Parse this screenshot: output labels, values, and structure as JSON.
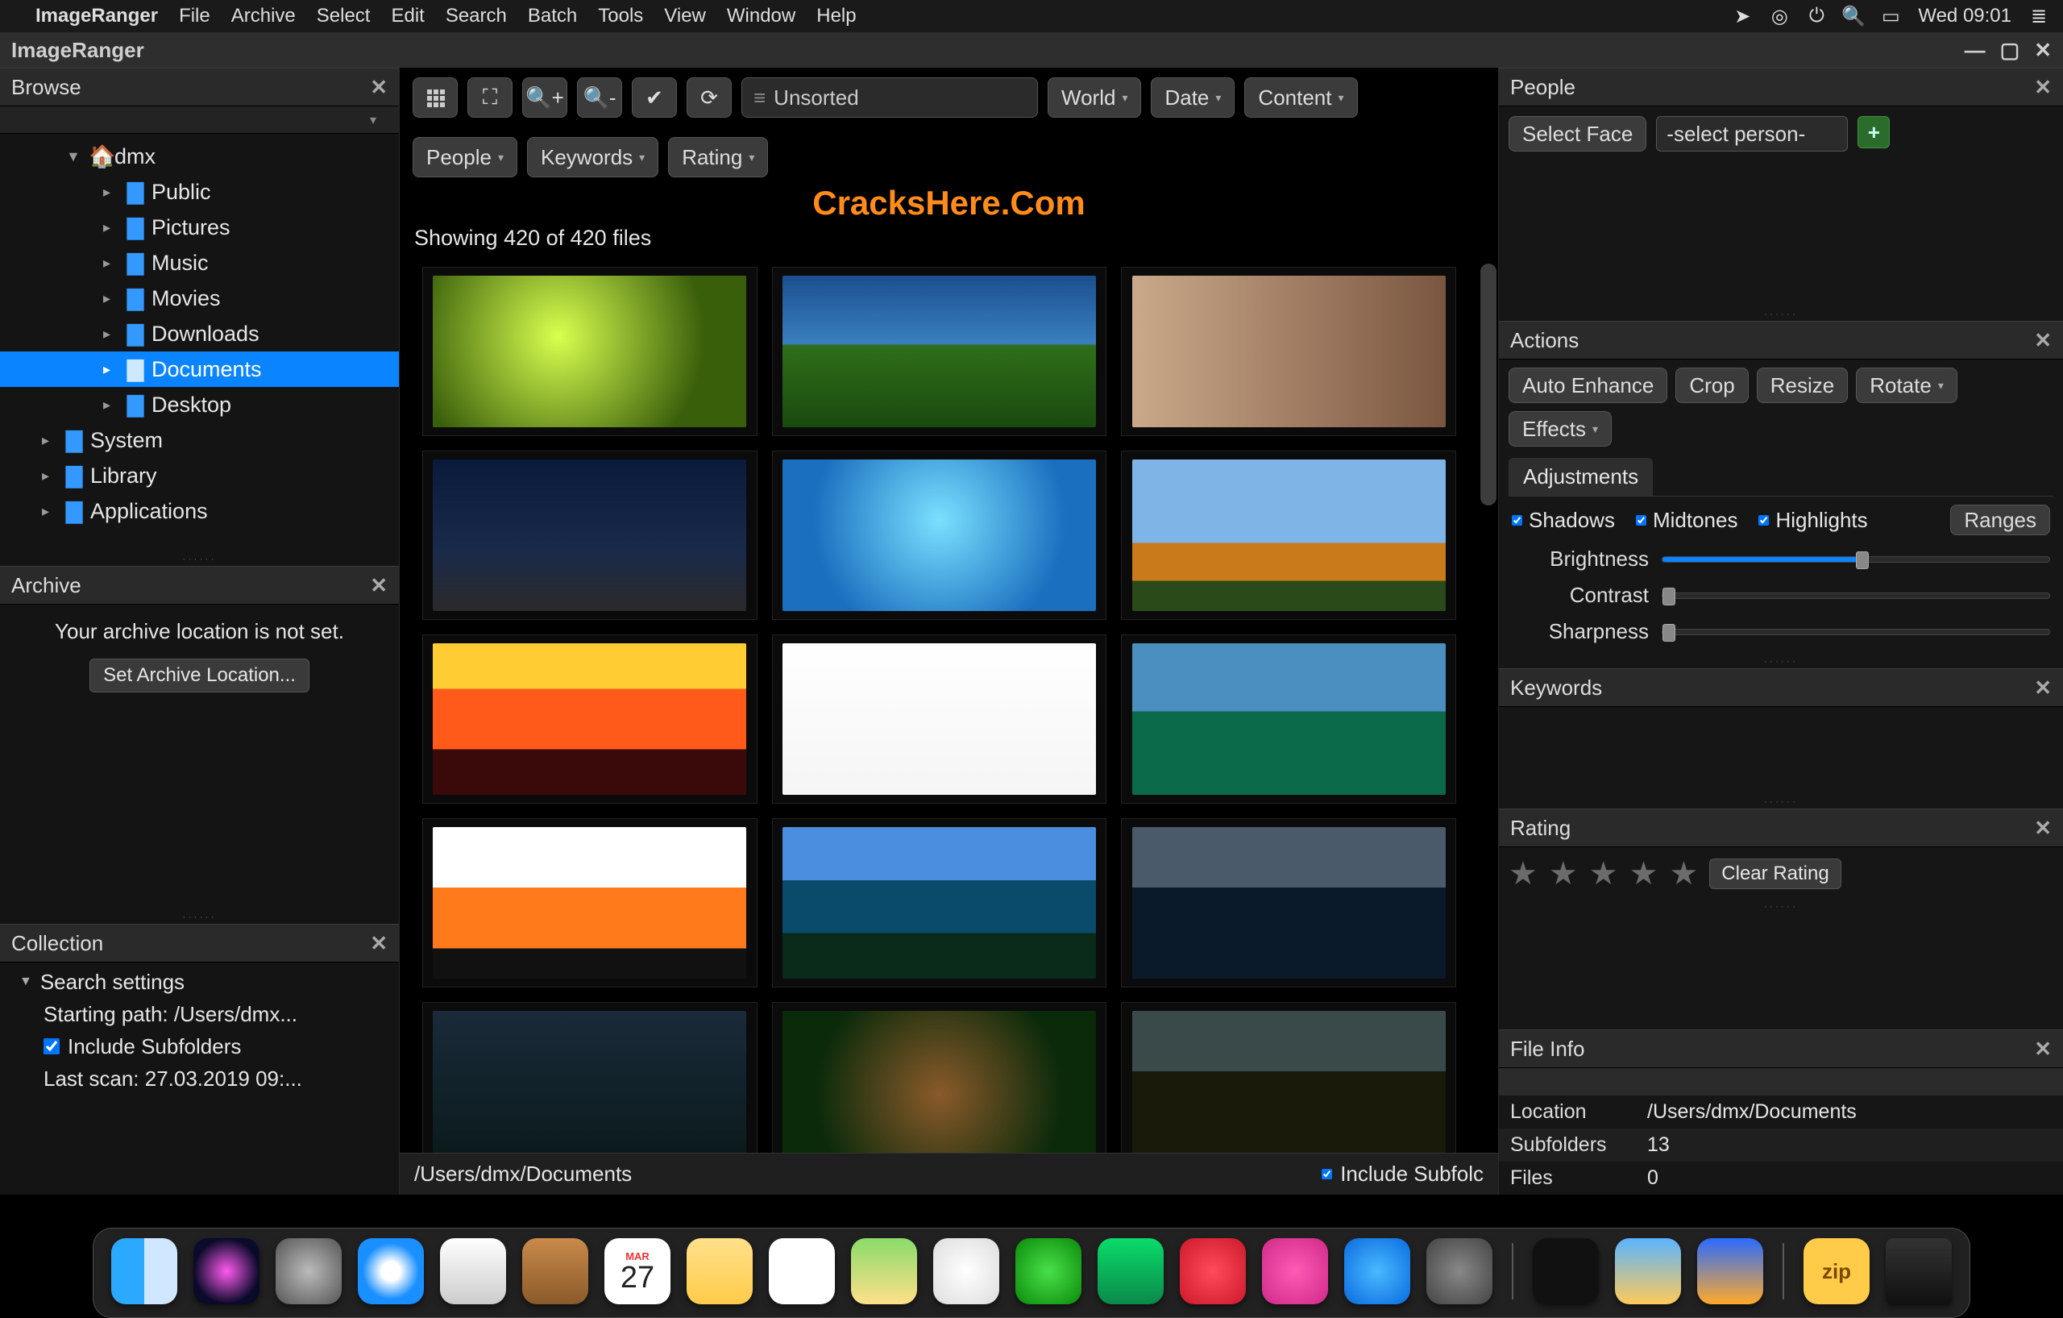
{
  "menubar": {
    "app": "ImageRanger",
    "items": [
      "File",
      "Archive",
      "Select",
      "Edit",
      "Search",
      "Batch",
      "Tools",
      "View",
      "Window",
      "Help"
    ],
    "clock": "Wed 09:01"
  },
  "titlebar": {
    "title": "ImageRanger"
  },
  "browse": {
    "title": "Browse",
    "root": {
      "label": "dmx"
    },
    "children": [
      "Public",
      "Pictures",
      "Music",
      "Movies",
      "Downloads",
      "Documents",
      "Desktop"
    ],
    "selected": "Documents",
    "siblings": [
      "System",
      "Library",
      "Applications"
    ]
  },
  "archive": {
    "title": "Archive",
    "msg": "Your archive location is not set.",
    "btn": "Set Archive Location..."
  },
  "collection": {
    "title": "Collection",
    "search_settings": "Search settings",
    "starting_path": "Starting path: /Users/dmx...",
    "include_sub": "Include Subfolders",
    "last_scan": "Last scan: 27.03.2019 09:..."
  },
  "center": {
    "sort_label": "Unsorted",
    "btns": {
      "world": "World",
      "date": "Date",
      "content": "Content",
      "people": "People",
      "keywords": "Keywords",
      "rating": "Rating"
    },
    "link": "CracksHere.Com",
    "status": "Showing 420 of 420 files",
    "path": "/Users/dmx/Documents",
    "include_sub": "Include Subfolc"
  },
  "people": {
    "title": "People",
    "select_face": "Select Face",
    "select_person": "-select person-"
  },
  "actions": {
    "title": "Actions",
    "btns": {
      "auto": "Auto Enhance",
      "crop": "Crop",
      "resize": "Resize",
      "rotate": "Rotate",
      "effects": "Effects"
    },
    "tab": "Adjustments",
    "checks": {
      "shadows": "Shadows",
      "midtones": "Midtones",
      "highlights": "Highlights"
    },
    "ranges": "Ranges",
    "sliders": {
      "brightness": "Brightness",
      "contrast": "Contrast",
      "sharpness": "Sharpness"
    }
  },
  "keywords": {
    "title": "Keywords"
  },
  "rating": {
    "title": "Rating",
    "clear": "Clear Rating"
  },
  "fileinfo": {
    "title": "File Info",
    "rows": {
      "location_k": "Location",
      "location_v": "/Users/dmx/Documents",
      "subfolders_k": "Subfolders",
      "subfolders_v": "13",
      "files_k": "Files",
      "files_v": "0"
    }
  },
  "dock": {
    "zip_label": "zip",
    "cal_day": "27",
    "cal_mon": "MAR"
  }
}
